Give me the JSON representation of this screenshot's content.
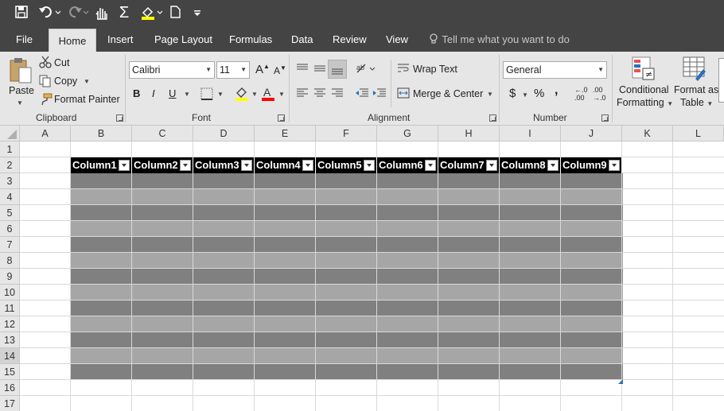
{
  "qat": {
    "icons": [
      "save-icon",
      "undo-icon",
      "redo-icon",
      "touch-mode-icon",
      "autosum-icon",
      "fill-color-icon",
      "new-file-icon",
      "customize-qat-icon"
    ]
  },
  "tabs": [
    "File",
    "Home",
    "Insert",
    "Page Layout",
    "Formulas",
    "Data",
    "Review",
    "View"
  ],
  "tell_me": "Tell me what you want to do",
  "clipboard": {
    "paste": "Paste",
    "cut": "Cut",
    "copy": "Copy",
    "format_painter": "Format Painter",
    "label": "Clipboard"
  },
  "font": {
    "name": "Calibri",
    "size": "11",
    "bold": "B",
    "italic": "I",
    "underline": "U",
    "label": "Font",
    "highlight_color": "#ffff00",
    "font_color": "#ff0000"
  },
  "alignment": {
    "wrap_text": "Wrap Text",
    "merge_center": "Merge & Center",
    "label": "Alignment"
  },
  "number": {
    "format": "General",
    "currency": "$",
    "percent": "%",
    "comma": ",",
    "inc_dec_a": "←.0",
    "inc_dec_a2": ".00",
    "inc_dec_b": ".00",
    "inc_dec_b2": "→.0",
    "label": "Number"
  },
  "styles": {
    "conditional": "Conditional",
    "conditional2": "Formatting",
    "format_as": "Format as",
    "format_as2": "Table"
  },
  "sheet": {
    "columns": [
      "A",
      "B",
      "C",
      "D",
      "E",
      "F",
      "G",
      "H",
      "I",
      "J",
      "K",
      "L"
    ],
    "rows": [
      "1",
      "2",
      "3",
      "4",
      "5",
      "6",
      "7",
      "8",
      "9",
      "10",
      "11",
      "12",
      "13",
      "14",
      "15",
      "16",
      "17"
    ],
    "table_headers": [
      "Column1",
      "Column2",
      "Column3",
      "Column4",
      "Column5",
      "Column6",
      "Column7",
      "Column8",
      "Column9"
    ],
    "band_colors": [
      "#808080",
      "#a6a6a6"
    ]
  }
}
